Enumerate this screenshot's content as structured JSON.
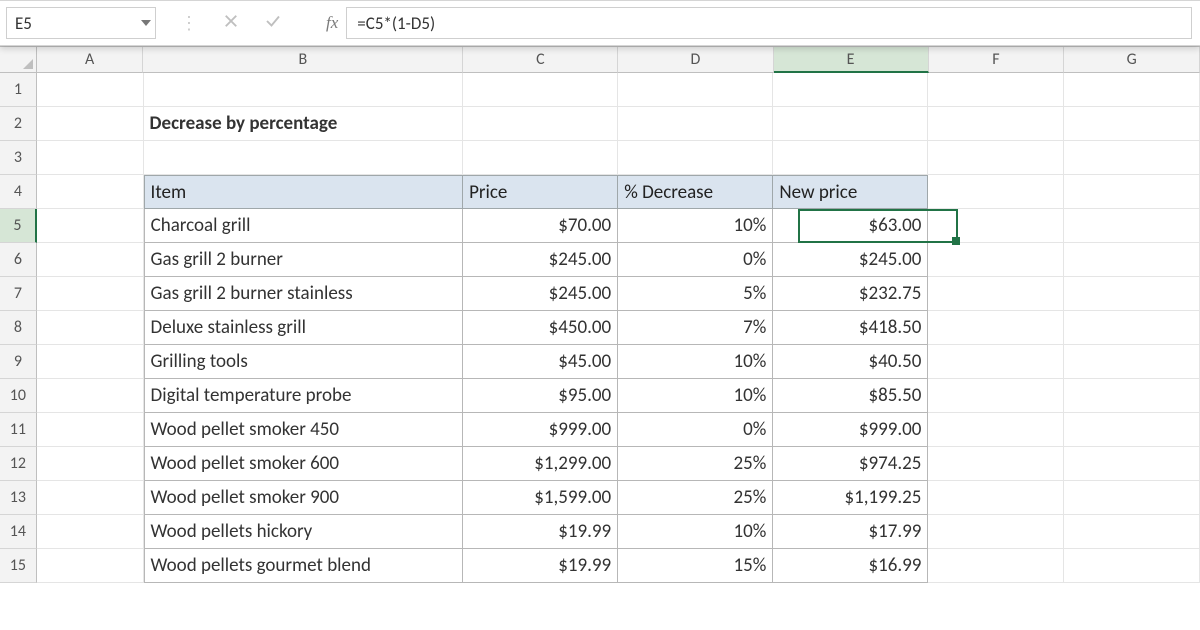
{
  "namebox": {
    "value": "E5"
  },
  "formula_bar": {
    "formula": "=C5*(1-D5)"
  },
  "columns": [
    "A",
    "B",
    "C",
    "D",
    "E",
    "F",
    "G"
  ],
  "active_col": "E",
  "active_row": 5,
  "title": "Decrease by percentage",
  "table_headers": {
    "item": "Item",
    "price": "Price",
    "decrease": "% Decrease",
    "newprice": "New price"
  },
  "rows": [
    {
      "item": "Charcoal grill",
      "price": "$70.00",
      "decrease": "10%",
      "newprice": "$63.00"
    },
    {
      "item": "Gas grill 2 burner",
      "price": "$245.00",
      "decrease": "0%",
      "newprice": "$245.00"
    },
    {
      "item": "Gas grill 2 burner stainless",
      "price": "$245.00",
      "decrease": "5%",
      "newprice": "$232.75"
    },
    {
      "item": "Deluxe stainless grill",
      "price": "$450.00",
      "decrease": "7%",
      "newprice": "$418.50"
    },
    {
      "item": "Grilling tools",
      "price": "$45.00",
      "decrease": "10%",
      "newprice": "$40.50"
    },
    {
      "item": "Digital temperature probe",
      "price": "$95.00",
      "decrease": "10%",
      "newprice": "$85.50"
    },
    {
      "item": "Wood pellet smoker 450",
      "price": "$999.00",
      "decrease": "0%",
      "newprice": "$999.00"
    },
    {
      "item": "Wood pellet smoker 600",
      "price": "$1,299.00",
      "decrease": "25%",
      "newprice": "$974.25"
    },
    {
      "item": "Wood pellet smoker 900",
      "price": "$1,599.00",
      "decrease": "25%",
      "newprice": "$1,199.25"
    },
    {
      "item": "Wood pellets hickory",
      "price": "$19.99",
      "decrease": "10%",
      "newprice": "$17.99"
    },
    {
      "item": "Wood pellets gourmet blend",
      "price": "$19.99",
      "decrease": "15%",
      "newprice": "$16.99"
    }
  ]
}
